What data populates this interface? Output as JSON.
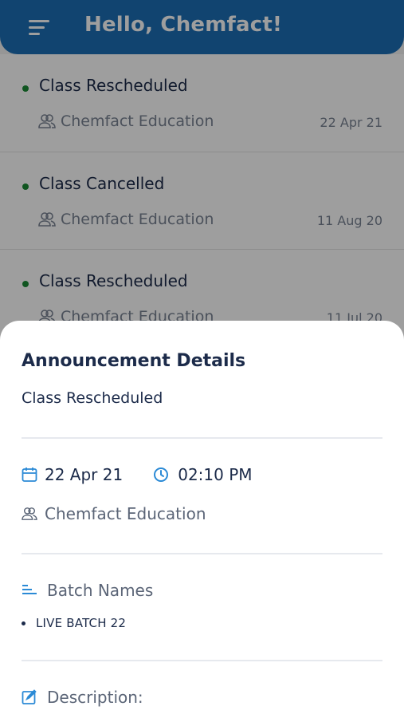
{
  "header": {
    "title": "Hello, Chemfact!",
    "menu_icon": "menu-icon"
  },
  "announcements": [
    {
      "title": "Class Rescheduled",
      "organization": "Chemfact Education",
      "date": "22 Apr 21",
      "status_color": "#1a8a35"
    },
    {
      "title": "Class Cancelled",
      "organization": "Chemfact Education",
      "date": "11 Aug 20",
      "status_color": "#1a8a35"
    },
    {
      "title": "Class Rescheduled",
      "organization": "Chemfact Education",
      "date": "11 Jul 20",
      "status_color": "#1a8a35"
    }
  ],
  "details": {
    "heading": "Announcement Details",
    "title": "Class Rescheduled",
    "date": "22 Apr 21",
    "time": "02:10 PM",
    "organization": "Chemfact Education",
    "batch_label": "Batch Names",
    "batches": [
      "LIVE BATCH 22"
    ],
    "description_label": "Description:"
  },
  "colors": {
    "primary": "#1c6fb5",
    "accent": "#2b8ad6",
    "text": "#1c2b4a",
    "status_dot": "#1a8a35"
  }
}
